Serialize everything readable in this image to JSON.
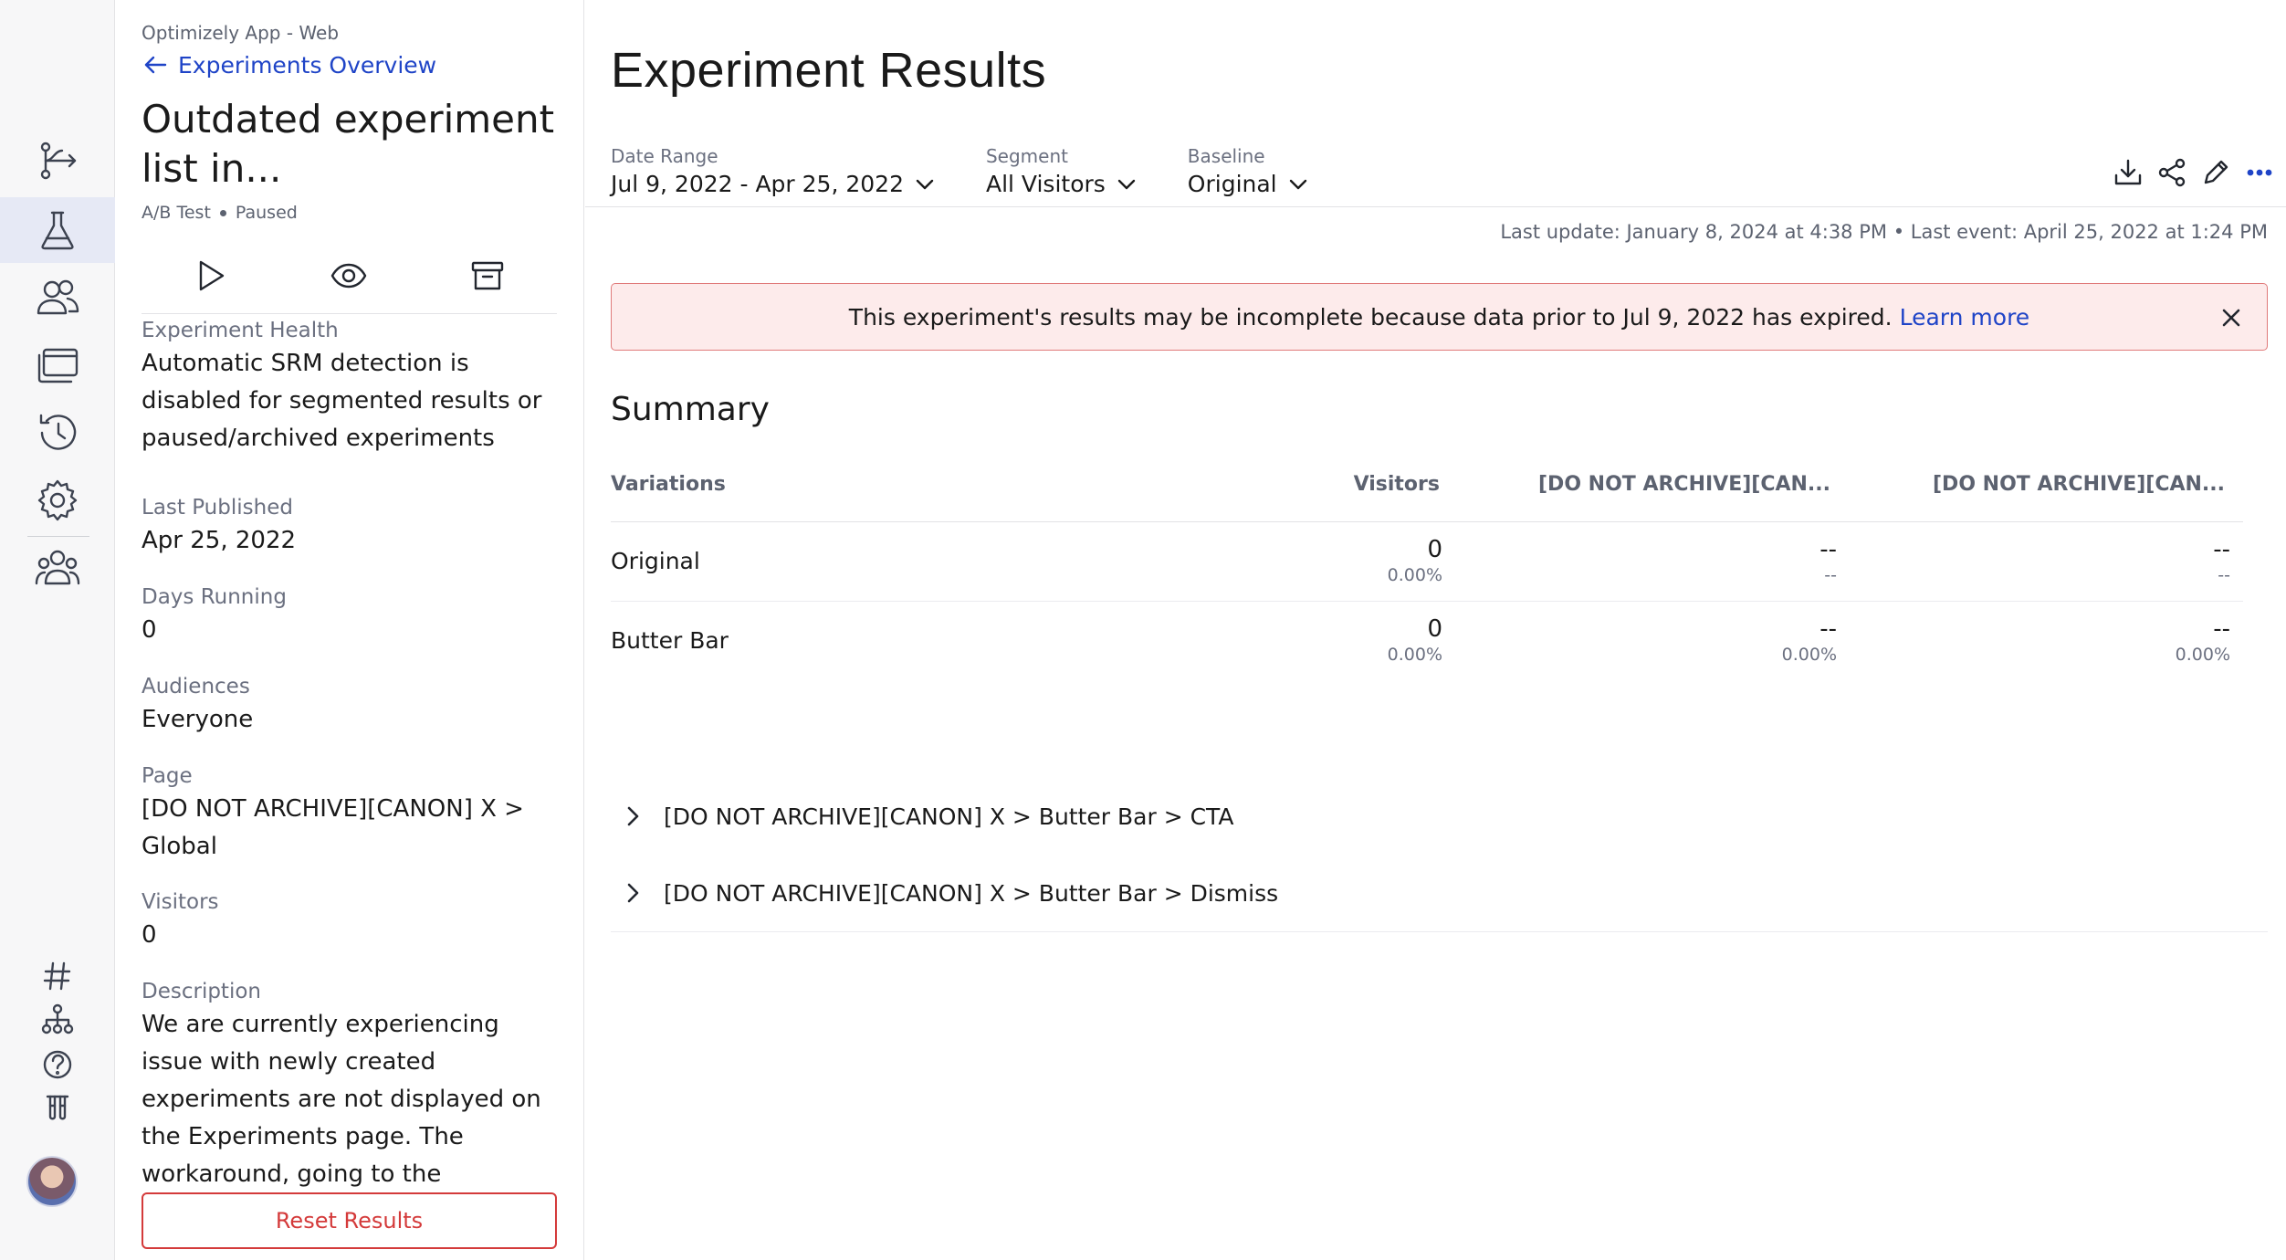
{
  "detail": {
    "app_name": "Optimizely App - Web",
    "back_label": "Experiments Overview",
    "title": "Outdated experiment list in...",
    "type": "A/B Test",
    "status": "Paused",
    "fields": {
      "health_label": "Experiment Health",
      "health_value": "Automatic SRM detection is disabled for segmented results or paused/archived experiments",
      "last_published_label": "Last Published",
      "last_published_value": "Apr 25, 2022",
      "days_running_label": "Days Running",
      "days_running_value": "0",
      "audiences_label": "Audiences",
      "audiences_value": "Everyone",
      "page_label": "Page",
      "page_value": "[DO NOT ARCHIVE][CANON] X > Global",
      "visitors_label": "Visitors",
      "visitors_value": "0",
      "description_label": "Description",
      "description_value": "We are currently experiencing issue with newly created experiments are not displayed on the Experiments page. The workaround, going to the experiment"
    },
    "reset_label": "Reset Results"
  },
  "main": {
    "title": "Experiment Results",
    "filters": {
      "date_range_label": "Date Range",
      "date_range_value": "Jul 9, 2022 - Apr 25, 2022",
      "segment_label": "Segment",
      "segment_value": "All Visitors",
      "baseline_label": "Baseline",
      "baseline_value": "Original"
    },
    "last_update": "Last update: January 8, 2024 at 4:38 PM",
    "last_event": "Last event: April 25, 2022 at 1:24 PM",
    "alert": {
      "text": "This experiment's results may be incomplete because data prior to Jul 9, 2022 has expired.",
      "link": "Learn more"
    },
    "summary": {
      "title": "Summary",
      "columns": [
        "Variations",
        "Visitors",
        "[DO NOT ARCHIVE][CAN...",
        "[DO NOT ARCHIVE][CAN..."
      ],
      "rows": [
        {
          "name": "Original",
          "visitors": "0",
          "visitors_pct": "0.00%",
          "m1": "--",
          "m1_sub": "--",
          "m2": "--",
          "m2_sub": "--"
        },
        {
          "name": "Butter Bar",
          "visitors": "0",
          "visitors_pct": "0.00%",
          "m1": "--",
          "m1_sub": "0.00%",
          "m2": "--",
          "m2_sub": "0.00%"
        }
      ]
    },
    "metrics": [
      "[DO NOT ARCHIVE][CANON] X > Butter Bar > CTA",
      "[DO NOT ARCHIVE][CANON] X > Butter Bar > Dismiss"
    ]
  },
  "icons": {
    "rail": [
      "flags-icon",
      "experiments-icon",
      "audiences-icon",
      "pages-icon",
      "history-icon",
      "settings-icon",
      "collaborators-icon"
    ],
    "rail_bottom": [
      "hash-icon",
      "hierarchy-icon",
      "help-icon",
      "lab-icon"
    ],
    "accent": "#1f44c7",
    "danger": "#d43a3a"
  }
}
